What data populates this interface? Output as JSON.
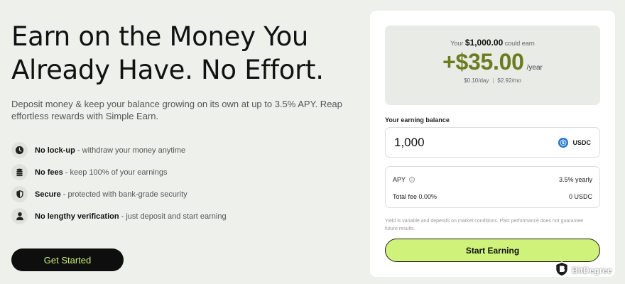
{
  "hero": {
    "title_line1": "Earn on the Money You",
    "title_line2": "Already Have. No Effort.",
    "subtitle": "Deposit money & keep your balance growing on its own at up to 3.5% APY. Reap effortless rewards with Simple Earn."
  },
  "features": [
    {
      "icon": "clock-icon",
      "title": "No lock-up",
      "desc": " - withdraw your money anytime"
    },
    {
      "icon": "coins-icon",
      "title": "No fees",
      "desc": " - keep 100% of your earnings"
    },
    {
      "icon": "shield-icon",
      "title": "Secure",
      "desc": " - protected with bank-grade security"
    },
    {
      "icon": "user-icon",
      "title": "No lengthy verification",
      "desc": " - just deposit and start earning"
    }
  ],
  "cta": {
    "label": "Get Started"
  },
  "calculator": {
    "earn_prefix": "Your ",
    "earn_amount_input": "$1,000.00",
    "earn_suffix": " could earn",
    "earn_amount": "+$35.00",
    "earn_period": "/year",
    "per_day": "$0.10/day",
    "separator": "|",
    "per_month": "$2.92/mo",
    "balance_label": "Your earning balance",
    "balance_value": "1,000",
    "currency": "USDC",
    "apy_label": "APY",
    "apy_value": "3.5% yearly",
    "fee_label": "Total fee 0.00%",
    "fee_value": "0 USDC",
    "disclaimer": "Yield is variable and depends on market conditions. Past performance does not guarantee future results.",
    "start_label": "Start Earning"
  },
  "watermark": {
    "text": "BitDegree"
  },
  "colors": {
    "background": "#eef0ec",
    "accent_lime": "#cff27a",
    "earn_green": "#6b7c1f",
    "usdc_blue": "#2775ca"
  }
}
